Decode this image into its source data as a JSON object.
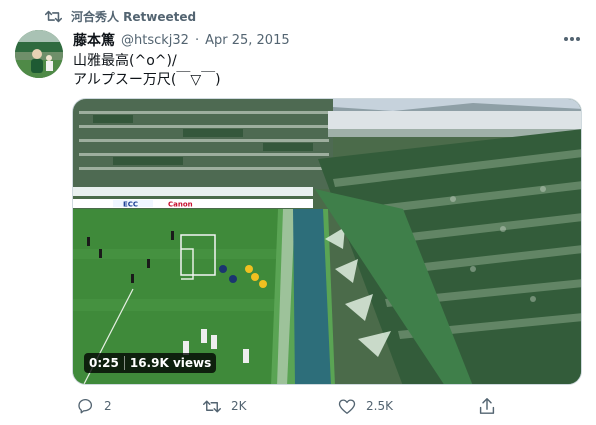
{
  "retweet_context": {
    "label": "河合秀人 Retweeted",
    "icon": "retweet-icon"
  },
  "tweet": {
    "display_name": "藤本篤",
    "handle": "@htsckj32",
    "separator": "·",
    "date": "Apr 25, 2015",
    "text": "山雅最高(^o^)/\nアルプスー万尺(￣▽￣)",
    "more_icon": "more-icon"
  },
  "media": {
    "type": "video",
    "duration": "0:25",
    "views": "16.9K views",
    "ad_boards": [
      "ECC",
      "Canon"
    ]
  },
  "actions": {
    "reply": {
      "icon": "reply-icon",
      "count": "2"
    },
    "retweet": {
      "icon": "retweet-icon",
      "count": "2K"
    },
    "like": {
      "icon": "heart-icon",
      "count": "2.5K"
    },
    "share": {
      "icon": "share-icon"
    }
  },
  "colors": {
    "text": "#0f1419",
    "secondary": "#536471",
    "pitch": "#3f8a3a",
    "crowd_green": "#2f6b3f"
  }
}
